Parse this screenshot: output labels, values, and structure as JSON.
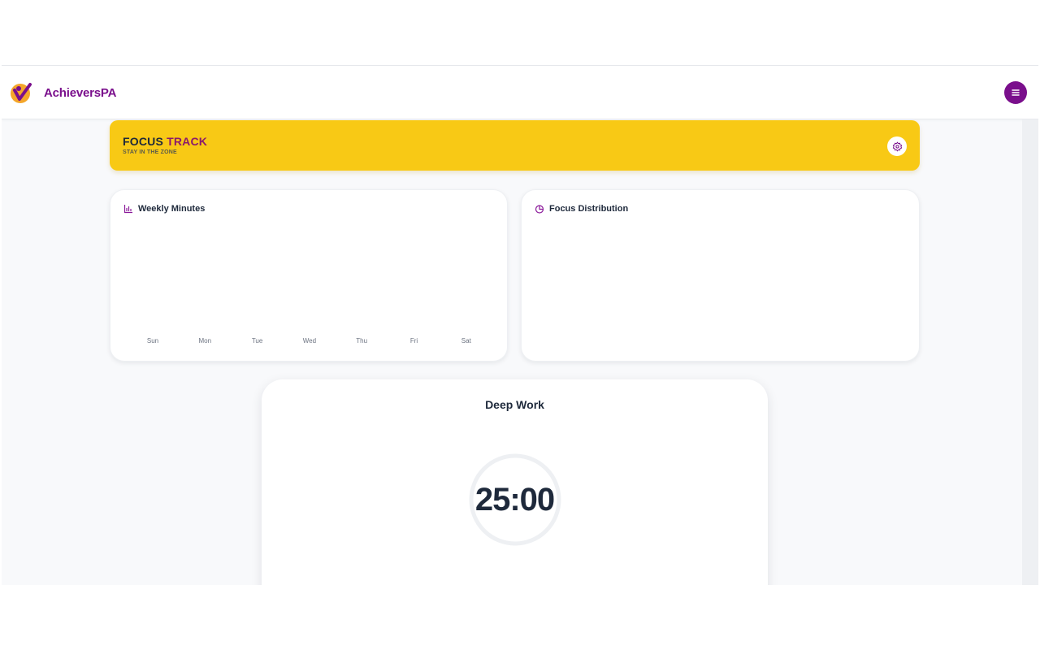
{
  "navbar": {
    "brand": "AchieversPA",
    "colors": {
      "brand": "#7a0f8c"
    }
  },
  "banner": {
    "title_main": "FOCUS",
    "title_accent": "TRACK",
    "subtitle": "STAY IN THE ZONE",
    "colors": {
      "background": "#f8c915",
      "accent": "#8b1a6b"
    }
  },
  "weekly_card": {
    "title": "Weekly Minutes",
    "icon": "bar-chart-icon",
    "days": [
      "Sun",
      "Mon",
      "Tue",
      "Wed",
      "Thu",
      "Fri",
      "Sat"
    ]
  },
  "distribution_card": {
    "title": "Focus Distribution",
    "icon": "pie-chart-icon"
  },
  "timer": {
    "mode": "Deep Work",
    "time": "25:00",
    "progress": 0
  }
}
